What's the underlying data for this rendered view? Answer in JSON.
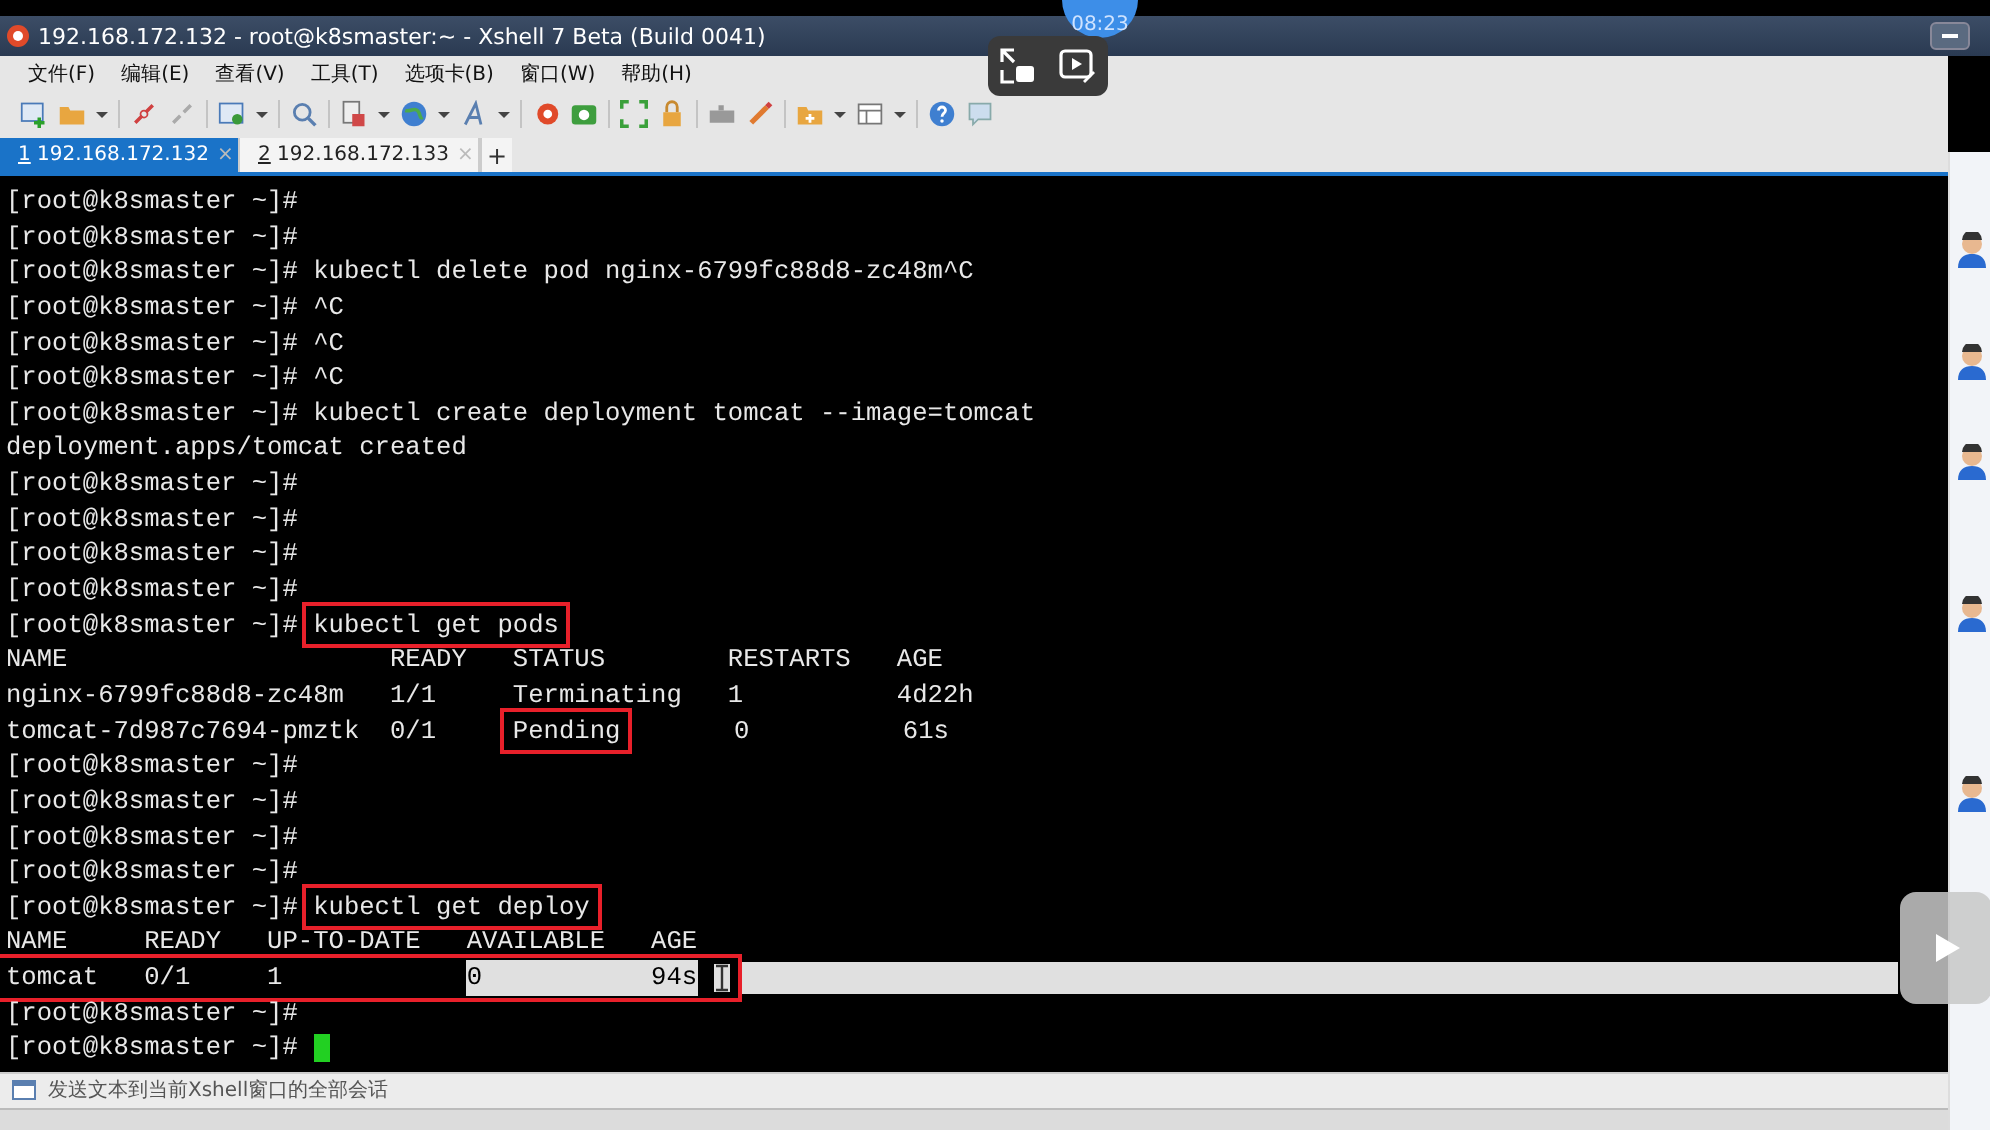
{
  "window": {
    "title": "192.168.172.132 - root@k8smaster:~ - Xshell 7 Beta (Build 0041)"
  },
  "video_overlay": {
    "time": "08:23"
  },
  "menu": [
    "文件(F)",
    "编辑(E)",
    "查看(V)",
    "工具(T)",
    "选项卡(B)",
    "窗口(W)",
    "帮助(H)"
  ],
  "tabs": [
    {
      "number": "1",
      "label": " 192.168.172.132",
      "selected": true,
      "close": "×"
    },
    {
      "number": "2",
      "label": " 192.168.172.133",
      "selected": false,
      "close": "×"
    }
  ],
  "new_tab": "+",
  "terminal": {
    "lines": [
      {
        "text": "[root@k8smaster ~]#"
      },
      {
        "text": "[root@k8smaster ~]#"
      },
      {
        "text": "[root@k8smaster ~]# kubectl delete pod nginx-6799fc88d8-zc48m^C"
      },
      {
        "text": "[root@k8smaster ~]# ^C"
      },
      {
        "text": "[root@k8smaster ~]# ^C"
      },
      {
        "text": "[root@k8smaster ~]# ^C"
      },
      {
        "text": "[root@k8smaster ~]# kubectl create deployment tomcat --image=tomcat"
      },
      {
        "text": "deployment.apps/tomcat created"
      },
      {
        "text": "[root@k8smaster ~]#"
      },
      {
        "text": "[root@k8smaster ~]#"
      },
      {
        "text": "[root@k8smaster ~]#"
      },
      {
        "text": "[root@k8smaster ~]#"
      },
      {
        "text": "[root@k8smaster ~]# ",
        "boxed": [
          {
            "text": "kubectl get pods",
            "selected": false
          }
        ]
      },
      {
        "text": "NAME                     READY   STATUS        RESTARTS   AGE"
      },
      {
        "text": "nginx-6799fc88d8-zc48m   1/1     Terminating   1          4d22h"
      },
      {
        "text": "tomcat-7d987c7694-pmztk  0/1     ",
        "boxed": [
          {
            "text": "Pending",
            "selected": false
          }
        ],
        "rest": "       0          61s"
      },
      {
        "text": "[root@k8smaster ~]#"
      },
      {
        "text": "[root@k8smaster ~]#"
      },
      {
        "text": "[root@k8smaster ~]#"
      },
      {
        "text": "[root@k8smaster ~]#"
      },
      {
        "text": "[root@k8smaster ~]# ",
        "boxed": [
          {
            "text": "kubectl get deploy",
            "selected": false
          }
        ]
      },
      {
        "text": "NAME     READY   UP-TO-DATE   AVAILABLE   AGE"
      },
      {
        "boxed": [
          {
            "text": "tomcat   0/1     1            ",
            "selected": false
          },
          {
            "text": "0           94s",
            "selected": true
          }
        ],
        "selection_extends": true,
        "text_cursor": true
      },
      {
        "text": "[root@k8smaster ~]#"
      },
      {
        "text": "[root@k8smaster ~]# ",
        "cursor": true
      }
    ]
  },
  "compose_bar": {
    "placeholder": "发送文本到当前Xshell窗口的全部会话"
  }
}
